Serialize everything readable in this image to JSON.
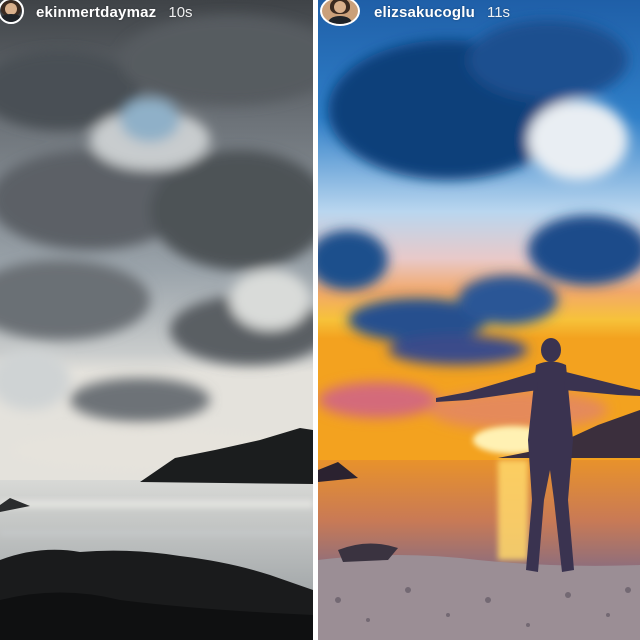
{
  "stories": [
    {
      "username": "ekinmertdaymaz",
      "time": "10s",
      "scene": "cloudy sea at dusk with rocky island"
    },
    {
      "username": "elizsakucoglu",
      "time": "11s",
      "scene": "sunset over sea, person with open arms on pebble beach"
    }
  ],
  "colors": {
    "divider": "#ffffff",
    "text": "#ffffff",
    "sunset_orange": "#f3a21f",
    "sky_blue": "#2f7fc8"
  }
}
